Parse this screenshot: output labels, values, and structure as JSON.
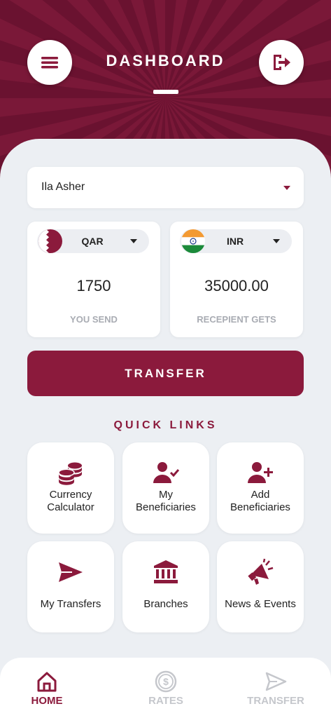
{
  "header": {
    "title": "DASHBOARD"
  },
  "icons": {
    "menu": "menu-icon",
    "logout": "logout-icon",
    "dropdown": "chevron-down-icon"
  },
  "colors": {
    "primary": "#8b1a3c",
    "header": "#7a1838",
    "background": "#eceff3",
    "muted": "#a9acb3"
  },
  "beneficiary_select": {
    "value": "Ila Asher"
  },
  "send": {
    "currency": "QAR",
    "amount": "1750",
    "label": "YOU SEND"
  },
  "receive": {
    "currency": "INR",
    "amount": "35000.00",
    "label": "RECEPIENT GETS"
  },
  "transfer_button": {
    "label": "TRANSFER"
  },
  "quick_links": {
    "title": "QUICK LINKS",
    "items": [
      {
        "line1": "Currency",
        "line2": "Calculator",
        "icon": "coins-icon"
      },
      {
        "line1": "My",
        "line2": "Beneficiaries",
        "icon": "user-check-icon"
      },
      {
        "line1": "Add",
        "line2": "Beneficiaries",
        "icon": "user-plus-icon"
      },
      {
        "line1": "My Transfers",
        "icon": "paper-plane-icon"
      },
      {
        "line1": "Branches",
        "icon": "bank-icon"
      },
      {
        "line1": "News & Events",
        "icon": "megaphone-icon"
      }
    ]
  },
  "bottom_nav": {
    "items": [
      {
        "label": "HOME",
        "icon": "home-icon",
        "active": true
      },
      {
        "label": "RATES",
        "icon": "dollar-coin-icon",
        "active": false
      },
      {
        "label": "TRANSFER",
        "icon": "send-icon",
        "active": false
      }
    ]
  }
}
